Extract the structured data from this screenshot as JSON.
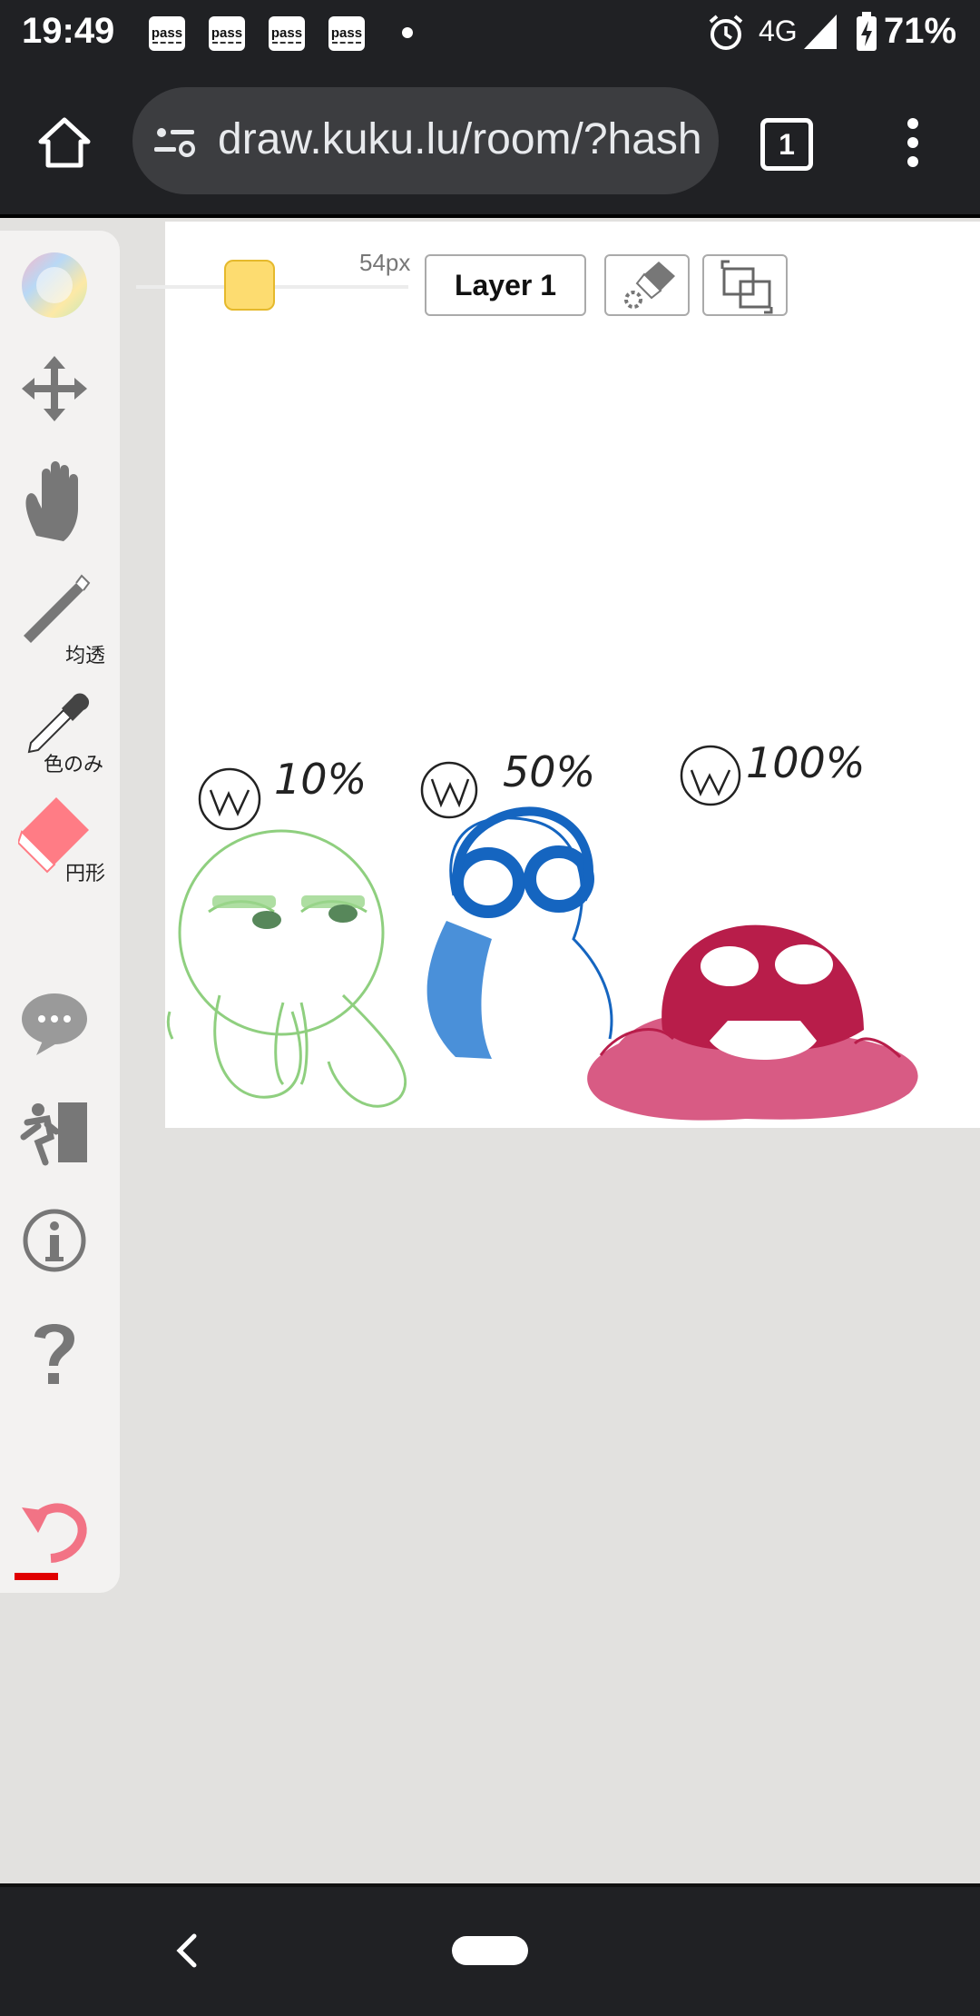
{
  "status_bar": {
    "time": "19:49",
    "notification_label": "pass",
    "network": "4G",
    "battery": "71%"
  },
  "browser": {
    "url": "draw.kuku.lu/room/?hash",
    "tab_count": "1"
  },
  "toolbar": {
    "brush_size": "54px",
    "layer_label": "Layer 1"
  },
  "tools": {
    "pen_label": "均透",
    "eyedropper_label": "色のみ",
    "eraser_label": "円形"
  },
  "canvas_text": {
    "low": "10%",
    "mid": "50%",
    "high": "100%"
  },
  "colors": {
    "green": "#8fcf7f",
    "blue": "#1565c0",
    "crimson": "#b81d4a",
    "brush": "#fddc70"
  }
}
